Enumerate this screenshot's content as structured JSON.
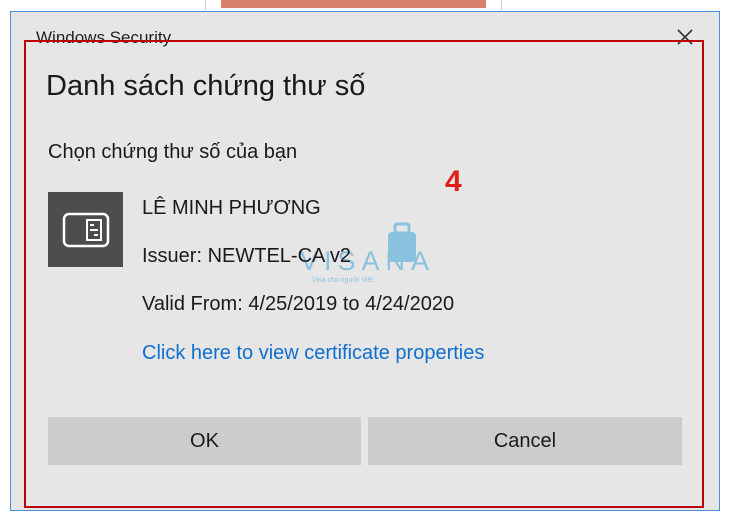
{
  "window": {
    "title": "Windows Security",
    "close_icon": "close-icon"
  },
  "dialog": {
    "title": "Danh sách chứng thư số",
    "subtitle": "Chọn chứng thư số của bạn",
    "annotation": "4"
  },
  "certificate": {
    "icon": "certificate-icon",
    "name": "LÊ MINH PHƯƠNG",
    "issuer": "Issuer: NEWTEL-CA v2",
    "valid": "Valid From: 4/25/2019 to 4/24/2020",
    "link": "Click here to view certificate properties"
  },
  "watermark": {
    "text": "VISANA",
    "subtext": "Visa cho người Việt"
  },
  "buttons": {
    "ok": "OK",
    "cancel": "Cancel"
  },
  "colors": {
    "link": "#0f6fcf",
    "annotation": "#e0201b",
    "frame": "#c00000",
    "watermark": "#3fa3d9"
  }
}
